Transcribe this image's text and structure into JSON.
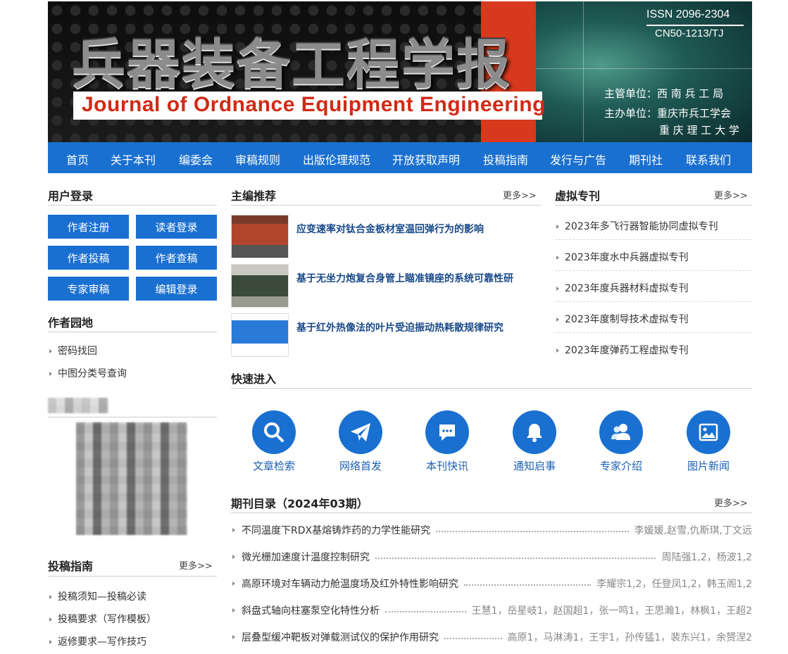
{
  "banner": {
    "title_cn": "兵器装备工程学报",
    "title_en": "Journal of Ordnance  Equipment  Engineering",
    "issn": "ISSN 2096-2304",
    "cn": "CN50-1213/TJ",
    "org_lines": [
      "主管单位：西 南 兵 工 局",
      "主办单位：重庆市兵工学会",
      "重 庆 理 工 大 学"
    ],
    "colors": {
      "accent_red": "#d8391c",
      "nav_blue": "#1a70d0"
    }
  },
  "nav": {
    "items": [
      "首页",
      "关于本刊",
      "编委会",
      "审稿规则",
      "出版伦理规范",
      "开放获取声明",
      "投稿指南",
      "发行与广告",
      "期刊社",
      "联系我们"
    ]
  },
  "login": {
    "title": "用户登录",
    "buttons": [
      "作者注册",
      "读者登录",
      "作者投稿",
      "作者查稿",
      "专家审稿",
      "编辑登录"
    ]
  },
  "author_garden": {
    "title": "作者园地",
    "items": [
      "密码找回",
      "中图分类号查询"
    ]
  },
  "submission_guide": {
    "title": "投稿指南",
    "more": "更多>>",
    "items": [
      "投稿须知—投稿必读",
      "投稿要求（写作模板）",
      "返修要求—写作技巧"
    ]
  },
  "editor_picks": {
    "title": "主编推荐",
    "more": "更多>>",
    "items": [
      "应变速率对钛合金板材室温回弹行为的影响",
      "基于无坐力炮复合身管上瞄准镜座的系统可靠性研",
      "基于红外热像法的叶片受迫振动热耗散规律研究"
    ]
  },
  "virtual_issues": {
    "title": "虚拟专刊",
    "more": "更多>>",
    "items": [
      "2023年多飞行器智能协同虚拟专刊",
      "2023年度水中兵器虚拟专刊",
      "2023年度兵器材料虚拟专刊",
      "2023年度制导技术虚拟专刊",
      "2023年度弹药工程虚拟专刊"
    ]
  },
  "quick_access": {
    "title": "快速进入",
    "items": [
      {
        "label": "文章检索",
        "icon": "search-icon"
      },
      {
        "label": "网络首发",
        "icon": "paper-plane-icon"
      },
      {
        "label": "本刊快讯",
        "icon": "chat-bubble-icon"
      },
      {
        "label": "通知启事",
        "icon": "bell-icon"
      },
      {
        "label": "专家介绍",
        "icon": "users-icon"
      },
      {
        "label": "图片新闻",
        "icon": "image-icon"
      }
    ]
  },
  "toc": {
    "title": "期刊目录（2024年03期）",
    "more": "更多>>",
    "items": [
      {
        "title": "不同温度下RDX基熔铸炸药的力学性能研究",
        "authors": "李媛媛,赵雪,仇斯琪,丁文远"
      },
      {
        "title": "微光栅加速度计温度控制研究",
        "authors": "周陆强1,2，杨波1,2"
      },
      {
        "title": "高原环境对车辆动力舱温度场及红外特性影响研究",
        "authors": "李耀宗1,2，任登凤1,2，韩玉阁1,2"
      },
      {
        "title": "斜盘式轴向柱塞泵空化特性分析",
        "authors": "王慧1，岳星岐1，赵国超1，张一鸣1，王思瀚1，林枫1，王超2"
      },
      {
        "title": "层叠型缓冲靶板对弹载测试仪的保护作用研究",
        "authors": "高原1，马淋涛1，王宇1，孙传猛1，裴东兴1，余赟涅2"
      }
    ]
  }
}
